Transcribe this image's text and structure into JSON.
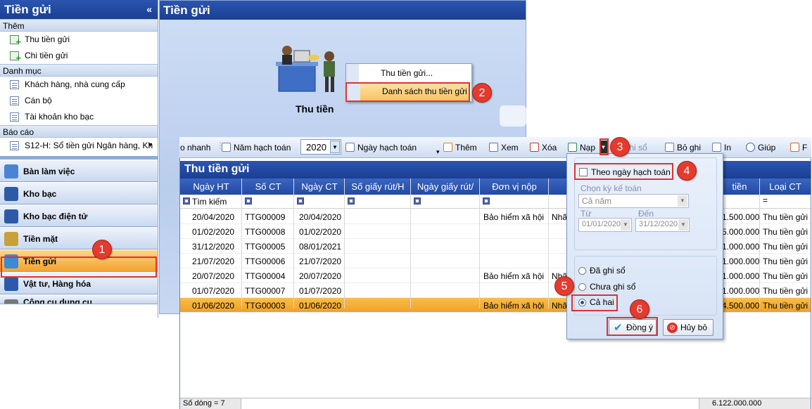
{
  "left_panel": {
    "title": "Tiền gửi",
    "collapse_icon": "«",
    "section_them": "Thêm",
    "them_items": [
      "Thu tiền gửi",
      "Chi tiền gửi"
    ],
    "section_danh_muc": "Danh mục",
    "danh_muc_items": [
      "Khách hàng, nhà cung cấp",
      "Cán bộ",
      "Tài khoản kho bạc"
    ],
    "section_bao_cao": "Báo cáo",
    "bao_cao_item": "S12-H: Sổ tiền gửi Ngân hàng, Kh",
    "modules": [
      "Bàn làm việc",
      "Kho bạc",
      "Kho bạc điện tử",
      "Tiền mặt",
      "Tiền gửi",
      "Vật tư, Hàng hóa",
      "Công cụ dụng cụ"
    ]
  },
  "back_window": {
    "title": "Tiền gửi",
    "illustration_label": "Thu tiền"
  },
  "context_menu": {
    "items": [
      "Thu tiền gửi...",
      "Danh sách thu tiền gửi"
    ]
  },
  "toolbar": {
    "nhanh": "o nhanh",
    "nam_label": "Năm hạch toán",
    "year_value": "2020",
    "ngay_label": "Ngày hạch toán",
    "them": "Thêm",
    "xem": "Xem",
    "xoa": "Xóa",
    "nap": "Nạp",
    "ghi_so": "Ghi sổ",
    "bo_ghi": "Bỏ ghi",
    "in": "In",
    "giup": "Giúp",
    "extra": "F"
  },
  "grid": {
    "title": "Thu tiền gửi",
    "columns": [
      "Ngày HT",
      "Số CT",
      "Ngày CT",
      "Số giấy rút/H",
      "Ngày giấy rút/",
      "Đơn vị nộp",
      "tiền",
      "Loại CT"
    ],
    "filter_label": "Tìm kiếm",
    "filter_eq": "=",
    "rows": [
      {
        "ngay_ht": "20/04/2020",
        "so_ct": "TTG00009",
        "ngay_ct": "20/04/2020",
        "don_vi": "Bảo hiểm xã hội",
        "nha": "Nhã",
        "tien": "1.500.000",
        "loai": "Thu tiền gửi"
      },
      {
        "ngay_ht": "01/02/2020",
        "so_ct": "TTG00008",
        "ngay_ct": "01/02/2020",
        "don_vi": "",
        "nha": "",
        "tien": "5.000.000",
        "loai": "Thu tiền gửi"
      },
      {
        "ngay_ht": "31/12/2020",
        "so_ct": "TTG00005",
        "ngay_ct": "08/01/2021",
        "don_vi": "",
        "nha": "",
        "tien": "1.000.000",
        "loai": "Thu tiền gửi"
      },
      {
        "ngay_ht": "21/07/2020",
        "so_ct": "TTG00006",
        "ngay_ct": "21/07/2020",
        "don_vi": "",
        "nha": "",
        "tien": "1.000.000",
        "loai": "Thu tiền gửi"
      },
      {
        "ngay_ht": "20/07/2020",
        "so_ct": "TTG00004",
        "ngay_ct": "20/07/2020",
        "don_vi": "Bảo hiểm xã hội",
        "nha": "Nhã",
        "tien": "1.000.000",
        "loai": "Thu tiền gửi"
      },
      {
        "ngay_ht": "01/07/2020",
        "so_ct": "TTG00007",
        "ngay_ct": "01/07/2020",
        "don_vi": "",
        "nha": "",
        "tien": "1.000.000",
        "loai": "Thu tiền gửi"
      },
      {
        "ngay_ht": "01/06/2020",
        "so_ct": "TTG00003",
        "ngay_ct": "01/06/2020",
        "don_vi": "Bảo hiểm xã hội",
        "nha": "Nhã",
        "tien": "4.500.000",
        "loai": "Thu tiền gửi"
      }
    ],
    "row_count": "Số dòng = 7",
    "total": "6.122.000.000"
  },
  "popup": {
    "checkbox_label": "Theo ngày hạch toán",
    "chon_ky_label": "Chọn kỳ kế toán",
    "ky_value": "Cả năm",
    "tu_label": "Từ",
    "den_label": "Đến",
    "tu_value": "01/01/2020",
    "den_value": "31/12/2020",
    "radio_options": [
      "Đã ghi sổ",
      "Chưa ghi sổ",
      "Cả hai"
    ],
    "ok_label": "Đồng ý",
    "cancel_label": "Hủy bỏ"
  },
  "badges": [
    "1",
    "2",
    "3",
    "4",
    "5",
    "6"
  ],
  "colors": {
    "accent": "#1b3f93",
    "selected_row": "#f0a224",
    "annotation_red": "#e0322e"
  }
}
